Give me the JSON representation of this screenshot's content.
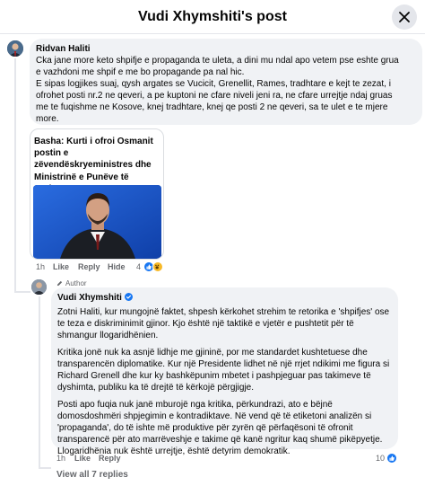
{
  "header": {
    "title": "Vudi Xhymshiti's post"
  },
  "comment1": {
    "author": "Ridvan Haliti",
    "lines": [
      "Cka jane more keto shpifje e propaganda te uleta, a dini mu ndal apo vetem pse eshte grua",
      "e vazhdoni me shpif e me bo propagande pa nal hic.",
      "E sipas logjikes suaj, qysh argates se Vucicit, Grenellit, Rames, tradhtare e kejt te zezat, i",
      "ofrohet posti nr.2 ne qeveri, a pe kuptoni ne cfare niveli jeni ra, ne cfare urrejtje ndaj gruas",
      "me te fuqishme ne Kosove, knej tradhtare, knej qe posti 2 ne qeveri, sa te ulet e te mjere",
      "more."
    ],
    "link_card": {
      "title": "Basha: Kurti i ofroi Osmanit postin e zëvendëskryeministres dhe Ministrinë e Punëve të Jashtme"
    },
    "actions": {
      "time": "1h",
      "like": "Like",
      "reply": "Reply",
      "hide": "Hide"
    },
    "reactions": {
      "count": "4"
    }
  },
  "reply1": {
    "badge": "Author",
    "author": "Vudi Xhymshiti",
    "paragraphs": [
      [
        "Zotni Haliti, kur mungojnë faktet, shpesh kërkohet strehim te retorika e 'shpifjes' ose",
        "te teza e diskriminimit gjinor. Kjo është një taktikë e vjetër e pushtetit për të",
        "shmangur llogaridhënien."
      ],
      [
        "Kritika jonë nuk ka asnjë lidhje me gjininë, por me standardet kushtetuese dhe",
        "transparencën diplomatike. Kur një Presidente lidhet në një rrjet ndikimi me figura si",
        "Richard Grenell dhe kur ky bashkëpunim mbetet i pashpjeguar pas takimeve të",
        "dyshimta, publiku ka të drejtë të kërkojë përgjigje."
      ],
      [
        "Posti apo fuqia nuk janë mburojë nga kritika, përkundrazi, ato e bëjnë",
        "domosdoshmëri shpjegimin e kontradiktave. Në vend që të etiketoni analizën si",
        "'propaganda', do të ishte më produktive për zyrën që përfaqësoni të ofronit",
        "transparencë për ato marrëveshje e takime që kanë ngritur kaq shumë pikëpyetje.",
        "Llogaridhënia nuk është urrejtje, është detyrim demokratik."
      ]
    ],
    "actions": {
      "time": "1h",
      "like": "Like",
      "reply": "Reply"
    },
    "reactions": {
      "count": "10"
    }
  },
  "view_replies": "View all 7 replies",
  "colors": {
    "like_blue": "#1877f2",
    "haha_yellow": "#f7b928",
    "verified_blue": "#1877f2",
    "bubble": "#f0f2f5"
  }
}
